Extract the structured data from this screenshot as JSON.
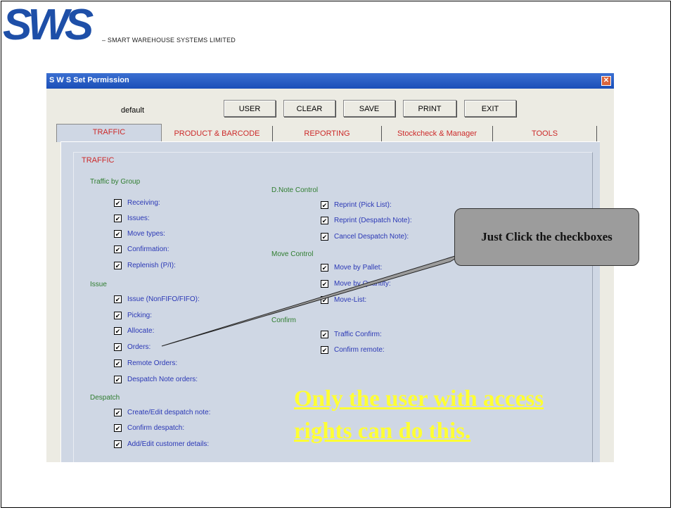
{
  "brand": {
    "logo_text": "SWS",
    "company": "– SMART WAREHOUSE SYSTEMS LIMITED",
    "logo_color": "#1e4fa8"
  },
  "window": {
    "title": "S W S  Set Permission",
    "close_icon": "close-icon",
    "user_name": "default",
    "buttons": {
      "user": "USER",
      "clear": "CLEAR",
      "save": "SAVE",
      "print": "PRINT",
      "exit": "EXIT"
    },
    "tabs": [
      {
        "label": "TRAFFIC",
        "active": true
      },
      {
        "label": "PRODUCT & BARCODE",
        "active": false
      },
      {
        "label": "REPORTING",
        "active": false
      },
      {
        "label": "Stockcheck & Manager",
        "active": false
      },
      {
        "label": "TOOLS",
        "active": false
      }
    ],
    "group_title": "TRAFFIC",
    "left_column": {
      "traffic_by_group": {
        "title": "Traffic by Group",
        "items": [
          "Receiving:",
          "Issues:",
          "Move types:",
          "Confirmation:",
          "Replenish (P/I):"
        ]
      },
      "issue": {
        "title": "Issue",
        "items": [
          "Issue (NonFIFO/FIFO):",
          "Picking:",
          "Allocate:",
          "Orders:",
          "Remote Orders:",
          "Despatch Note orders:"
        ]
      },
      "despatch": {
        "title": "Despatch",
        "items": [
          "Create/Edit despatch note:",
          "Confirm despatch:",
          "Add/Edit customer details:"
        ]
      }
    },
    "right_column": {
      "dnote_control": {
        "title": "D.Note Control",
        "items": [
          "Reprint (Pick List):",
          "Reprint (Despatch Note):",
          "Cancel Despatch Note):"
        ]
      },
      "move_control": {
        "title": "Move Control",
        "items": [
          "Move by Pallet:",
          "Move by Quantity:",
          "Move-List:"
        ]
      },
      "confirm": {
        "title": "Confirm",
        "items": [
          "Traffic Confirm:",
          "Confirm remote:"
        ]
      }
    },
    "checked": true,
    "check_mark": "✔"
  },
  "callout": {
    "text": "Just Click the checkboxes"
  },
  "note": {
    "text": "Only the user with access rights can do this."
  }
}
